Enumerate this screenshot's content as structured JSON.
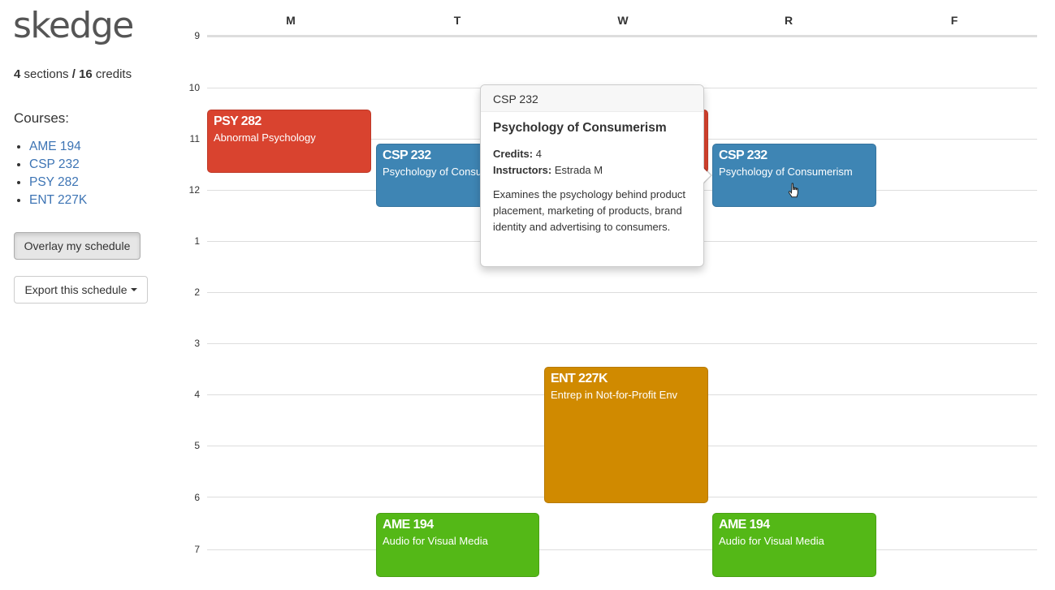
{
  "app": {
    "logo": "skedge"
  },
  "summary": {
    "sections_count": "4",
    "sections_label": "sections",
    "separator": "/",
    "credits_count": "16",
    "credits_label": "credits"
  },
  "courses": {
    "heading": "Courses:",
    "items": [
      {
        "label": "AME 194"
      },
      {
        "label": "CSP 232"
      },
      {
        "label": "PSY 282"
      },
      {
        "label": "ENT 227K"
      }
    ]
  },
  "buttons": {
    "overlay": "Overlay my schedule",
    "export": "Export this schedule"
  },
  "calendar": {
    "days": [
      "M",
      "T",
      "W",
      "R",
      "F"
    ],
    "hours": [
      "9",
      "10",
      "11",
      "12",
      "1",
      "2",
      "3",
      "4",
      "5",
      "6",
      "7"
    ],
    "events": [
      {
        "code": "PSY 282",
        "name": "Abnormal Psychology",
        "color": "#d9432f"
      },
      {
        "code": "CSP 232",
        "name": "Psychology of Consumerism",
        "color": "#3e85b4"
      },
      {
        "code": "CSP 232",
        "name": "Psychology of Consumerism",
        "color": "#3e85b4"
      },
      {
        "code": "ENT 227K",
        "name": "Entrep in Not-for-Profit Env",
        "color": "#d08a00"
      },
      {
        "code": "AME 194",
        "name": "Audio for Visual Media",
        "color": "#54b817"
      },
      {
        "code": "AME 194",
        "name": "Audio for Visual Media",
        "color": "#54b817"
      }
    ]
  },
  "popover": {
    "header": "CSP 232",
    "title": "Psychology of Consumerism",
    "credits_label": "Credits:",
    "credits_value": "4",
    "instructors_label": "Instructors:",
    "instructors_value": "Estrada M",
    "description": "Examines the psychology behind product placement, marketing of products, brand identity and advertising to consumers."
  },
  "icons": {
    "cursor": "hand-pointer-icon",
    "caret": "caret-down-icon"
  }
}
